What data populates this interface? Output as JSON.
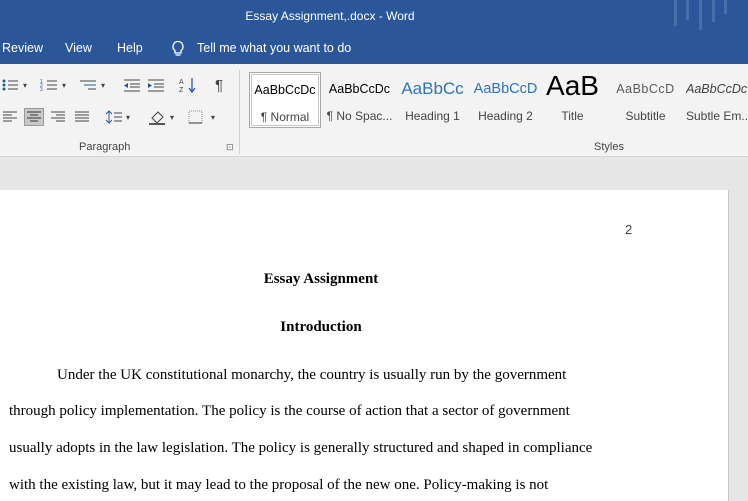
{
  "window": {
    "title": "Essay Assignment,.docx  -  Word"
  },
  "menu": {
    "review": "Review",
    "view": "View",
    "help": "Help",
    "tell_me": "Tell me what you want to do"
  },
  "ribbon": {
    "paragraph_label": "Paragraph",
    "styles_label": "Styles",
    "styles": [
      {
        "sample": "AaBbCcDc",
        "name": "¶ Normal"
      },
      {
        "sample": "AaBbCcDc",
        "name": "¶ No Spac..."
      },
      {
        "sample": "AaBbCc",
        "name": "Heading 1"
      },
      {
        "sample": "AaBbCcD",
        "name": "Heading 2"
      },
      {
        "sample": "AaB",
        "name": "Title"
      },
      {
        "sample": "AaBbCcD",
        "name": "Subtitle"
      },
      {
        "sample": "AaBbCcDc",
        "name": "Subtle Em..."
      }
    ]
  },
  "document": {
    "page_number": "2",
    "heading": "Essay Assignment",
    "subheading": "Introduction",
    "lines": [
      "Under the UK constitutional monarchy, the country is usually run by the government",
      "through policy implementation. The policy is the course of action that a sector of government",
      "usually adopts in the law legislation. The policy is generally structured and shaped in compliance",
      "with the existing law, but it may lead to the proposal of the new one. Policy-making is not"
    ]
  },
  "colors": {
    "word_blue": "#2b579a",
    "heading1_blue": "#2e74b5",
    "heading2_blue": "#2e74b5"
  }
}
